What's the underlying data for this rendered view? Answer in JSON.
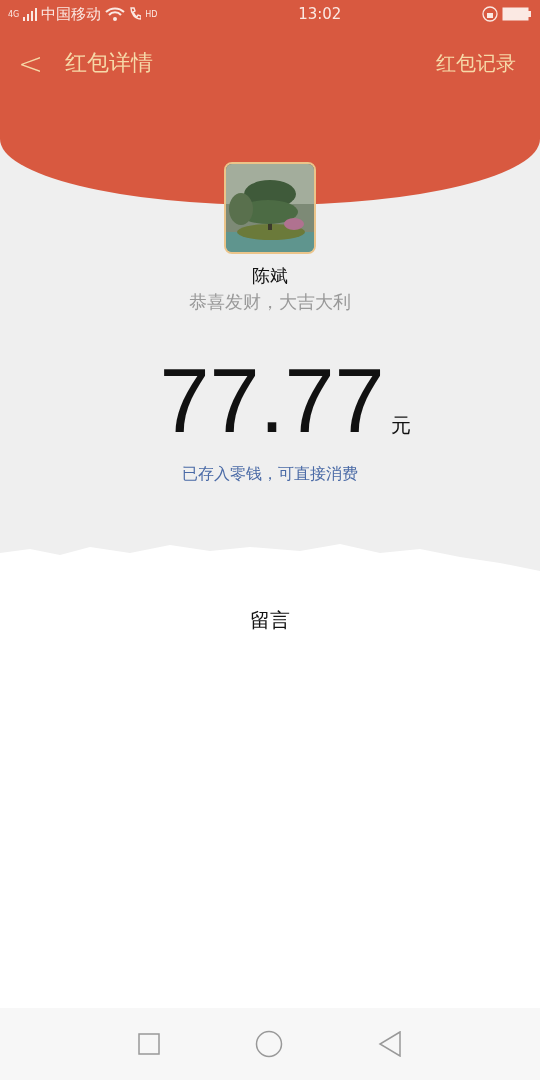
{
  "status_bar": {
    "network": "4G",
    "carrier": "中国移动",
    "call": "HD",
    "time": "13:02"
  },
  "nav": {
    "back": "<",
    "title": "红包详情",
    "action": "红包记录"
  },
  "sender": {
    "name": "陈斌",
    "greeting": "恭喜发财，大吉大利"
  },
  "amount": {
    "value": "77.77",
    "unit": "元"
  },
  "note": "已存入零钱，可直接消费",
  "message_label": "留言"
}
